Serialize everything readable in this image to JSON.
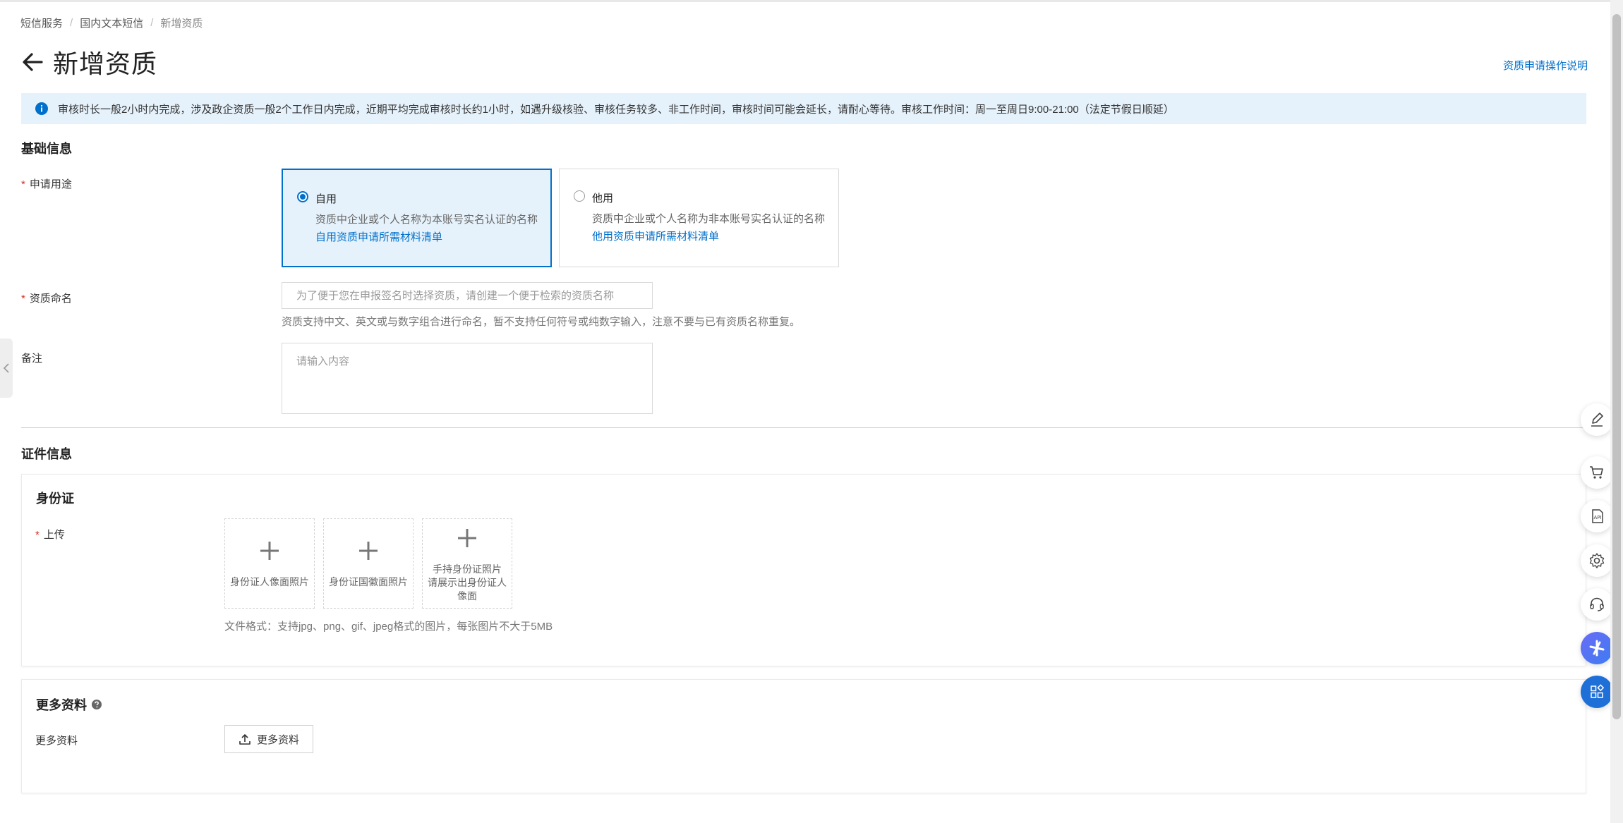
{
  "breadcrumb": [
    "短信服务",
    "国内文本短信",
    "新增资质"
  ],
  "page_title": "新增资质",
  "help_link": "资质申请操作说明",
  "notice": "审核时长一般2小时内完成，涉及政企资质一般2个工作日内完成，近期平均完成审核时长约1小时，如遇升级核验、审核任务较多、非工作时间，审核时间可能会延长，请耐心等待。审核工作时间：周一至周日9:00-21:00（法定节假日顺延）",
  "basic_info": {
    "title": "基础信息",
    "purpose": {
      "label": "申请用途",
      "options": [
        {
          "title": "自用",
          "desc": "资质中企业或个人名称为本账号实名认证的名称",
          "link": "自用资质申请所需材料清单",
          "selected": true
        },
        {
          "title": "他用",
          "desc": "资质中企业或个人名称为非本账号实名认证的名称",
          "link": "他用资质申请所需材料清单",
          "selected": false
        }
      ]
    },
    "name": {
      "label": "资质命名",
      "placeholder": "为了便于您在申报签名时选择资质，请创建一个便于检索的资质名称",
      "hint": "资质支持中文、英文或与数字组合进行命名，暂不支持任何符号或纯数字输入，注意不要与已有资质名称重复。"
    },
    "remark": {
      "label": "备注",
      "placeholder": "请输入内容"
    }
  },
  "cert_info": {
    "title": "证件信息",
    "id_card": {
      "title": "身份证",
      "upload_label": "上传",
      "boxes": [
        "身份证人像面照片",
        "身份证国徽面照片",
        "手持身份证照片\n请展示出身份证人像面"
      ],
      "hint": "文件格式：支持jpg、png、gif、jpeg格式的图片，每张图片不大于5MB"
    },
    "more": {
      "title": "更多资料",
      "label": "更多资料",
      "button": "更多资料"
    }
  },
  "colors": {
    "accent": "#0070cc",
    "notice_bg": "#e6f2fb",
    "required": "#d93026"
  },
  "floating_icons": [
    "edit-icon",
    "cart-icon",
    "api-icon",
    "gear-icon",
    "headset-icon",
    "ai-assistant-icon",
    "apps-icon"
  ]
}
